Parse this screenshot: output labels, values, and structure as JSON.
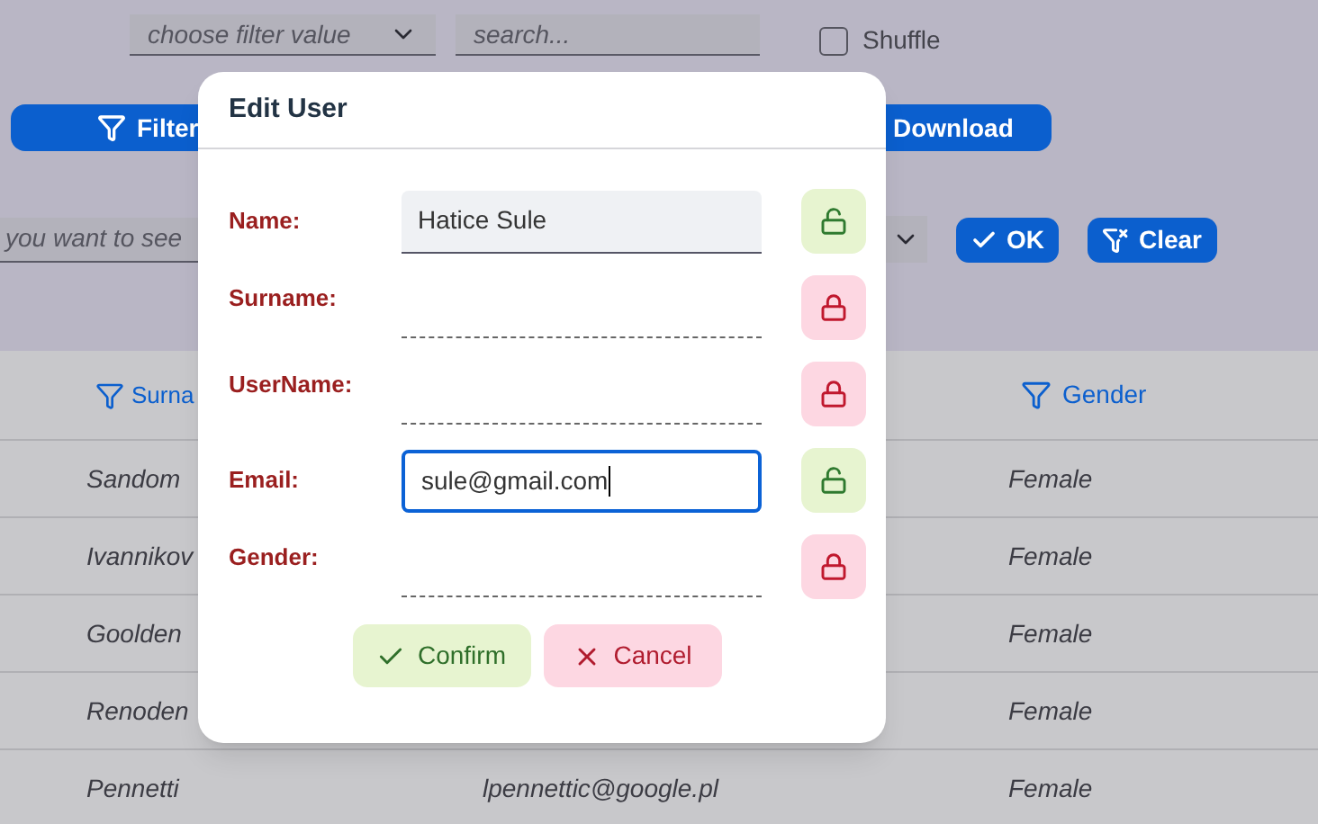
{
  "toolbar": {
    "filter_select": {
      "placeholder": "choose filter value"
    },
    "search": {
      "placeholder": "search..."
    },
    "shuffle": {
      "label": "Shuffle",
      "checked": false
    },
    "filter_button": "Filter",
    "download_button": "Download",
    "value_field": {
      "placeholder": "you want to see"
    },
    "ok_button": "OK",
    "clear_button": "Clear"
  },
  "table": {
    "columns": [
      "Surna",
      "Gender"
    ],
    "rows": [
      {
        "surname": "Sandom",
        "gender": "Female"
      },
      {
        "surname": "Ivannikov",
        "gender": "Female"
      },
      {
        "surname": "Goolden",
        "gender": "Female"
      },
      {
        "surname": "Renoden",
        "gender": "Female"
      },
      {
        "surname": "Pennetti",
        "email": "lpennettic@google.pl",
        "gender": "Female"
      }
    ]
  },
  "dialog": {
    "title": "Edit User",
    "fields": [
      {
        "label": "Name:",
        "value": "Hatice Sule",
        "locked": false,
        "focused": false
      },
      {
        "label": "Surname:",
        "locked": true
      },
      {
        "label": "UserName:",
        "locked": true
      },
      {
        "label": "Email:",
        "value": "sule@gmail.com",
        "locked": false,
        "focused": true
      },
      {
        "label": "Gender:",
        "locked": true
      }
    ],
    "confirm_button": "Confirm",
    "cancel_button": "Cancel"
  }
}
